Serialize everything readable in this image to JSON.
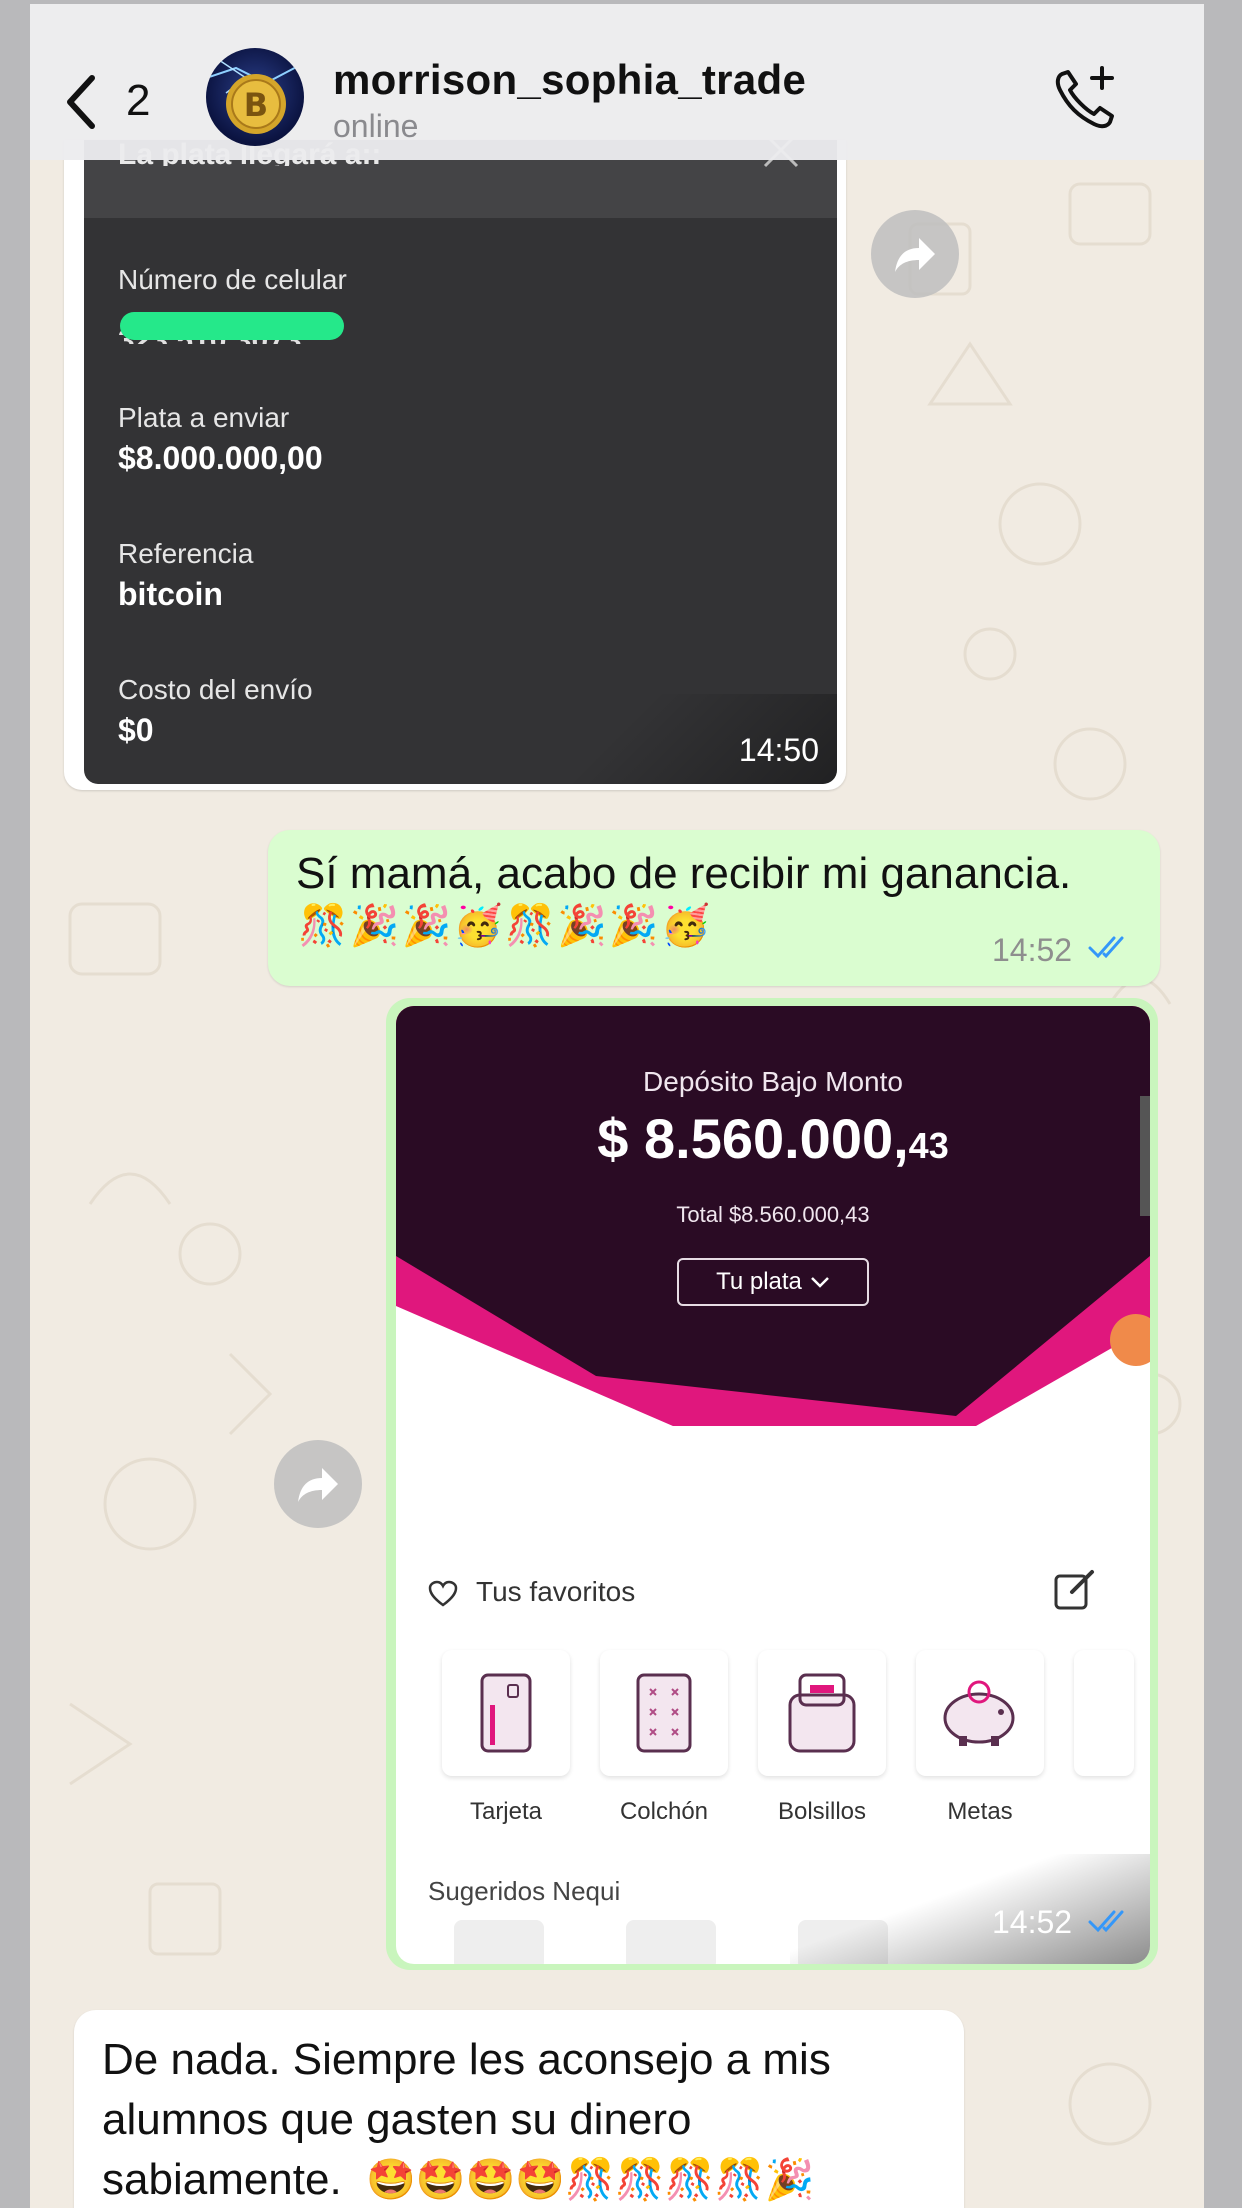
{
  "header": {
    "back_count": "2",
    "contact_name": "morrison_sophia_trade",
    "status": "online"
  },
  "messages": {
    "receipt": {
      "header": "La plata llegará a::",
      "phone_label": "Número de celular",
      "phone_value": "323 510 3073",
      "amount_label": "Plata a enviar",
      "amount_value": "$8.000.000,00",
      "reference_label": "Referencia",
      "reference_value": "bitcoin",
      "cost_label": "Costo del envío",
      "cost_value": "$0",
      "time": "14:50"
    },
    "outgoing_text": {
      "text": "Sí mamá, acabo de recibir mi ganancia.",
      "emojis": "🎊🎉🎉🥳🎊🎉🎉🥳",
      "time": "14:52"
    },
    "nequi_screenshot": {
      "deposit_title": "Depósito Bajo Monto",
      "amount_main": "$ 8.560.000,",
      "amount_cents": "43",
      "total": "Total $8.560.000,43",
      "tu_plata": "Tu plata",
      "favorites_label": "Tus favoritos",
      "favorites": [
        {
          "name": "Tarjeta",
          "icon": "card-icon"
        },
        {
          "name": "Colchón",
          "icon": "mattress-icon"
        },
        {
          "name": "Bolsillos",
          "icon": "pocket-icon"
        },
        {
          "name": "Metas",
          "icon": "piggy-bank-icon"
        }
      ],
      "suggested_label": "Sugeridos Nequi",
      "time": "14:52"
    },
    "incoming_text": {
      "line1": "De nada. Siempre les aconsejo a mis",
      "line2": "alumnos que gasten su dinero",
      "line3": "sabiamente.",
      "emojis": "🤩🤩🤩🤩🎊🎊🎊🎊🎉"
    }
  },
  "colors": {
    "outgoing_bubble": "#dafdd0",
    "incoming_bubble": "#ffffff",
    "chat_background": "#f1ebe2",
    "tick_blue": "#3497f9",
    "nequi_dark": "#2a0b24",
    "nequi_pink": "#e0177d"
  }
}
